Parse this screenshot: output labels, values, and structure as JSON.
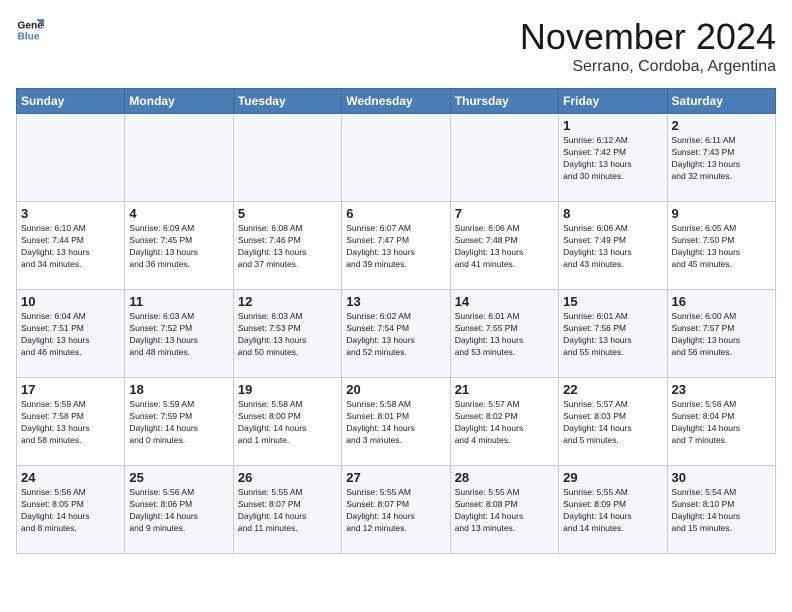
{
  "header": {
    "logo_line1": "General",
    "logo_line2": "Blue",
    "title": "November 2024",
    "subtitle": "Serrano, Cordoba, Argentina"
  },
  "weekdays": [
    "Sunday",
    "Monday",
    "Tuesday",
    "Wednesday",
    "Thursday",
    "Friday",
    "Saturday"
  ],
  "weeks": [
    [
      {
        "day": "",
        "info": ""
      },
      {
        "day": "",
        "info": ""
      },
      {
        "day": "",
        "info": ""
      },
      {
        "day": "",
        "info": ""
      },
      {
        "day": "",
        "info": ""
      },
      {
        "day": "1",
        "info": "Sunrise: 6:12 AM\nSunset: 7:42 PM\nDaylight: 13 hours\nand 30 minutes."
      },
      {
        "day": "2",
        "info": "Sunrise: 6:11 AM\nSunset: 7:43 PM\nDaylight: 13 hours\nand 32 minutes."
      }
    ],
    [
      {
        "day": "3",
        "info": "Sunrise: 6:10 AM\nSunset: 7:44 PM\nDaylight: 13 hours\nand 34 minutes."
      },
      {
        "day": "4",
        "info": "Sunrise: 6:09 AM\nSunset: 7:45 PM\nDaylight: 13 hours\nand 36 minutes."
      },
      {
        "day": "5",
        "info": "Sunrise: 6:08 AM\nSunset: 7:46 PM\nDaylight: 13 hours\nand 37 minutes."
      },
      {
        "day": "6",
        "info": "Sunrise: 6:07 AM\nSunset: 7:47 PM\nDaylight: 13 hours\nand 39 minutes."
      },
      {
        "day": "7",
        "info": "Sunrise: 6:06 AM\nSunset: 7:48 PM\nDaylight: 13 hours\nand 41 minutes."
      },
      {
        "day": "8",
        "info": "Sunrise: 6:06 AM\nSunset: 7:49 PM\nDaylight: 13 hours\nand 43 minutes."
      },
      {
        "day": "9",
        "info": "Sunrise: 6:05 AM\nSunset: 7:50 PM\nDaylight: 13 hours\nand 45 minutes."
      }
    ],
    [
      {
        "day": "10",
        "info": "Sunrise: 6:04 AM\nSunset: 7:51 PM\nDaylight: 13 hours\nand 46 minutes."
      },
      {
        "day": "11",
        "info": "Sunrise: 6:03 AM\nSunset: 7:52 PM\nDaylight: 13 hours\nand 48 minutes."
      },
      {
        "day": "12",
        "info": "Sunrise: 6:03 AM\nSunset: 7:53 PM\nDaylight: 13 hours\nand 50 minutes."
      },
      {
        "day": "13",
        "info": "Sunrise: 6:02 AM\nSunset: 7:54 PM\nDaylight: 13 hours\nand 52 minutes."
      },
      {
        "day": "14",
        "info": "Sunrise: 6:01 AM\nSunset: 7:55 PM\nDaylight: 13 hours\nand 53 minutes."
      },
      {
        "day": "15",
        "info": "Sunrise: 6:01 AM\nSunset: 7:56 PM\nDaylight: 13 hours\nand 55 minutes."
      },
      {
        "day": "16",
        "info": "Sunrise: 6:00 AM\nSunset: 7:57 PM\nDaylight: 13 hours\nand 56 minutes."
      }
    ],
    [
      {
        "day": "17",
        "info": "Sunrise: 5:59 AM\nSunset: 7:58 PM\nDaylight: 13 hours\nand 58 minutes."
      },
      {
        "day": "18",
        "info": "Sunrise: 5:59 AM\nSunset: 7:59 PM\nDaylight: 14 hours\nand 0 minutes."
      },
      {
        "day": "19",
        "info": "Sunrise: 5:58 AM\nSunset: 8:00 PM\nDaylight: 14 hours\nand 1 minute."
      },
      {
        "day": "20",
        "info": "Sunrise: 5:58 AM\nSunset: 8:01 PM\nDaylight: 14 hours\nand 3 minutes."
      },
      {
        "day": "21",
        "info": "Sunrise: 5:57 AM\nSunset: 8:02 PM\nDaylight: 14 hours\nand 4 minutes."
      },
      {
        "day": "22",
        "info": "Sunrise: 5:57 AM\nSunset: 8:03 PM\nDaylight: 14 hours\nand 5 minutes."
      },
      {
        "day": "23",
        "info": "Sunrise: 5:56 AM\nSunset: 8:04 PM\nDaylight: 14 hours\nand 7 minutes."
      }
    ],
    [
      {
        "day": "24",
        "info": "Sunrise: 5:56 AM\nSunset: 8:05 PM\nDaylight: 14 hours\nand 8 minutes."
      },
      {
        "day": "25",
        "info": "Sunrise: 5:56 AM\nSunset: 8:06 PM\nDaylight: 14 hours\nand 9 minutes."
      },
      {
        "day": "26",
        "info": "Sunrise: 5:55 AM\nSunset: 8:07 PM\nDaylight: 14 hours\nand 11 minutes."
      },
      {
        "day": "27",
        "info": "Sunrise: 5:55 AM\nSunset: 8:07 PM\nDaylight: 14 hours\nand 12 minutes."
      },
      {
        "day": "28",
        "info": "Sunrise: 5:55 AM\nSunset: 8:08 PM\nDaylight: 14 hours\nand 13 minutes."
      },
      {
        "day": "29",
        "info": "Sunrise: 5:55 AM\nSunset: 8:09 PM\nDaylight: 14 hours\nand 14 minutes."
      },
      {
        "day": "30",
        "info": "Sunrise: 5:54 AM\nSunset: 8:10 PM\nDaylight: 14 hours\nand 15 minutes."
      }
    ]
  ]
}
